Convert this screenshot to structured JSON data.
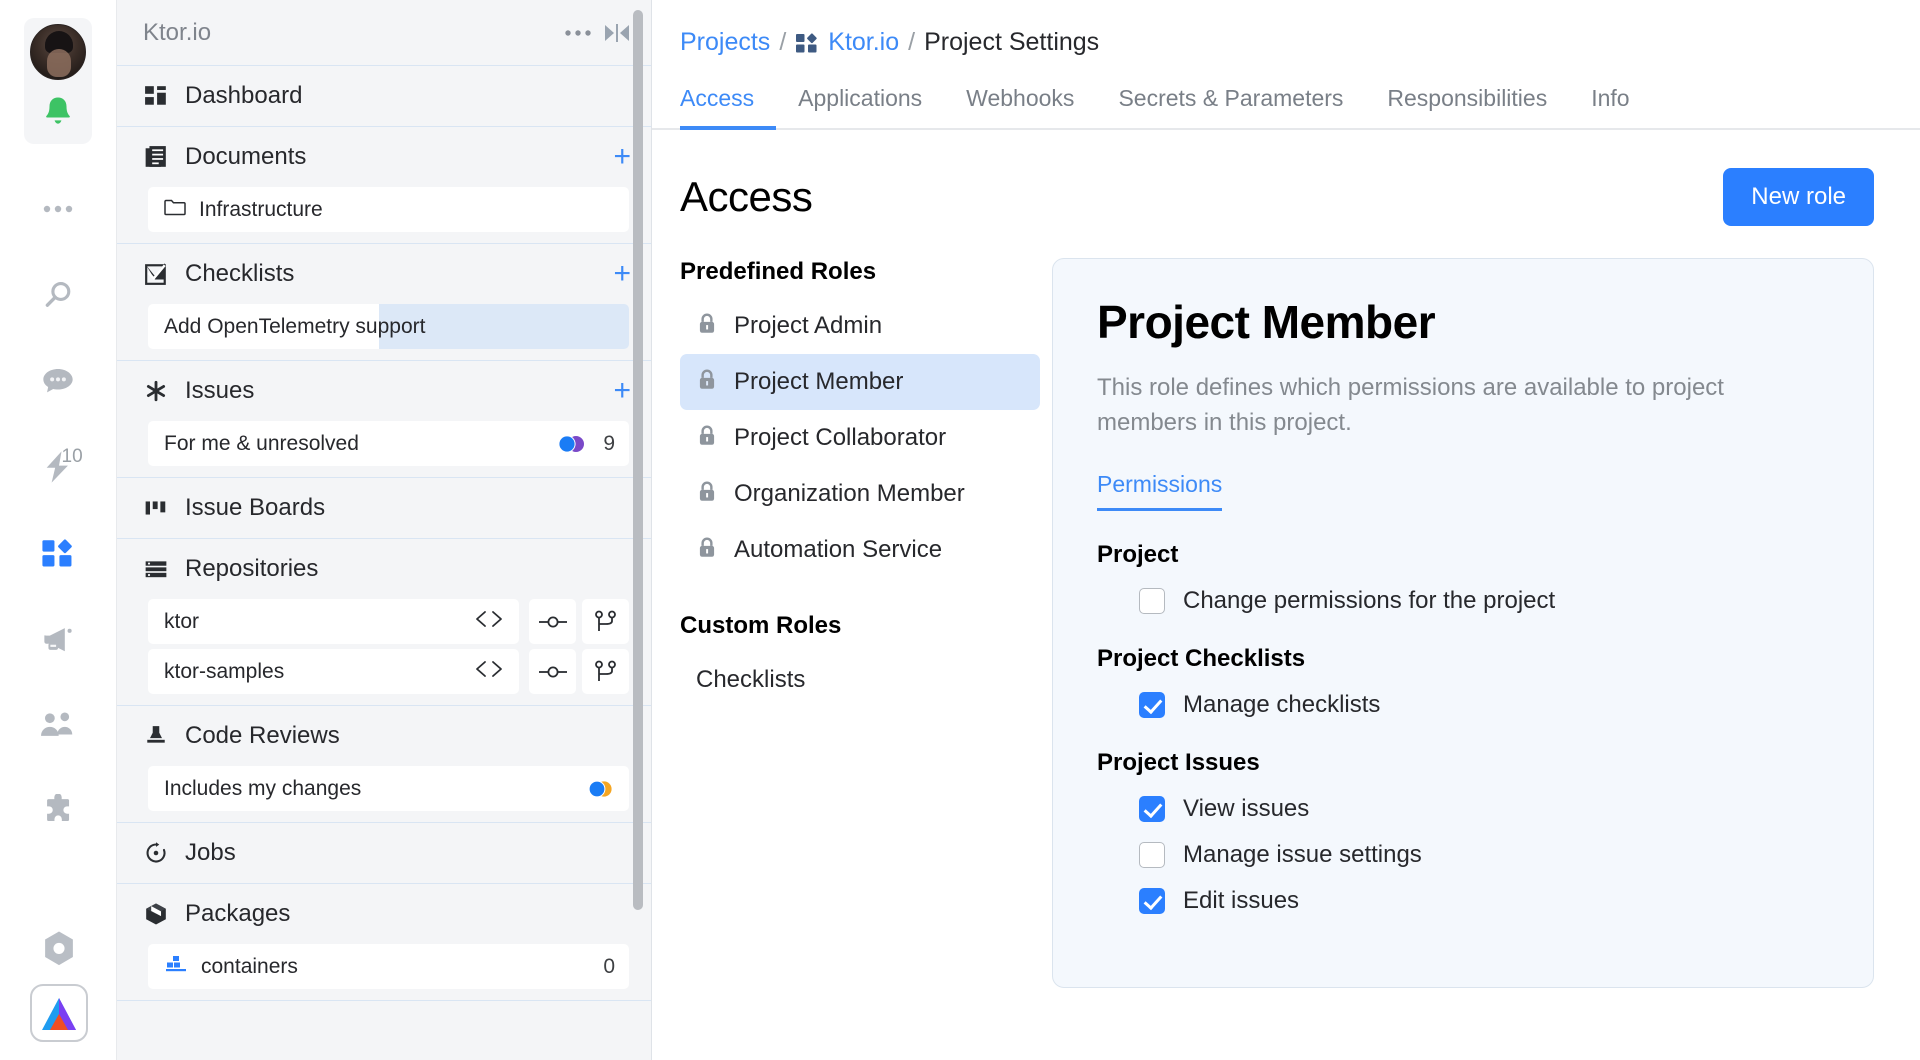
{
  "rail": {
    "avatar_name": "user-avatar",
    "notifications_icon": "bell-icon",
    "icons": [
      {
        "name": "more-icon",
        "glyph": "dots"
      },
      {
        "name": "search-icon",
        "glyph": "search"
      },
      {
        "name": "chat-icon",
        "glyph": "chat"
      },
      {
        "name": "automation-icon",
        "glyph": "bolt",
        "badge": "10"
      },
      {
        "name": "projects-icon",
        "glyph": "projects",
        "active": true
      },
      {
        "name": "blog-icon",
        "glyph": "megaphone"
      },
      {
        "name": "teams-icon",
        "glyph": "people"
      },
      {
        "name": "extensions-icon",
        "glyph": "puzzle"
      },
      {
        "name": "packages-rail-icon",
        "glyph": "hexnut"
      }
    ],
    "logo_name": "app-logo"
  },
  "sidebar": {
    "title": "Ktor.io",
    "more_icon": "ellipsis-icon",
    "collapse_icon": "collapse-panel-icon",
    "sections": [
      {
        "name": "dashboard",
        "label": "Dashboard",
        "icon": "dashboard-icon",
        "add": false,
        "children": []
      },
      {
        "name": "documents",
        "label": "Documents",
        "icon": "documents-icon",
        "add": true,
        "children": [
          {
            "name": "document-infrastructure",
            "label": "Infrastructure",
            "icon": "folder-icon"
          }
        ]
      },
      {
        "name": "checklists",
        "label": "Checklists",
        "icon": "checklist-icon",
        "add": true,
        "children": [
          {
            "name": "checklist-opentelemetry",
            "label": "Add OpenTelemetry support",
            "icon": null,
            "partial_select": true
          }
        ]
      },
      {
        "name": "issues",
        "label": "Issues",
        "icon": "issues-icon",
        "add": true,
        "children": [
          {
            "name": "issue-filter-for-me-unresolved",
            "label": "For me & unresolved",
            "icon": null,
            "count": "9",
            "avatars": true
          }
        ]
      },
      {
        "name": "issue-boards",
        "label": "Issue Boards",
        "icon": "issue-boards-icon",
        "add": false,
        "children": []
      },
      {
        "name": "repositories",
        "label": "Repositories",
        "icon": "repositories-icon",
        "add": false,
        "repos": [
          {
            "name": "repo-ktor",
            "label": "ktor",
            "actions": [
              "code-icon",
              "commits-icon",
              "branches-icon"
            ]
          },
          {
            "name": "repo-ktor-samples",
            "label": "ktor-samples",
            "actions": [
              "code-icon",
              "commits-icon",
              "branches-icon"
            ]
          }
        ]
      },
      {
        "name": "code-reviews",
        "label": "Code Reviews",
        "icon": "code-reviews-icon",
        "add": false,
        "children": [
          {
            "name": "review-filter-includes-my-changes",
            "label": "Includes my changes",
            "icon": null,
            "avatars": true
          }
        ]
      },
      {
        "name": "jobs",
        "label": "Jobs",
        "icon": "jobs-icon",
        "add": false,
        "children": []
      },
      {
        "name": "packages",
        "label": "Packages",
        "icon": "packages-icon",
        "add": false,
        "children": [
          {
            "name": "package-containers",
            "label": "containers",
            "icon": "containers-icon",
            "count": "0"
          }
        ]
      }
    ]
  },
  "breadcrumb": {
    "projects": "Projects",
    "sep1": "/",
    "project": "Ktor.io",
    "project_icon": "project-icon",
    "sep2": "/",
    "current": "Project Settings"
  },
  "tabs": [
    {
      "name": "tab-access",
      "label": "Access",
      "active": true
    },
    {
      "name": "tab-applications",
      "label": "Applications",
      "active": false
    },
    {
      "name": "tab-webhooks",
      "label": "Webhooks",
      "active": false
    },
    {
      "name": "tab-secrets-parameters",
      "label": "Secrets & Parameters",
      "active": false
    },
    {
      "name": "tab-responsibilities",
      "label": "Responsibilities",
      "active": false
    },
    {
      "name": "tab-info",
      "label": "Info",
      "active": false
    }
  ],
  "page": {
    "title": "Access",
    "new_role_button": "New role"
  },
  "roles": {
    "predefined_header": "Predefined Roles",
    "custom_header": "Custom Roles",
    "predefined": [
      {
        "name": "role-project-admin",
        "label": "Project Admin",
        "icon": "lock-icon",
        "active": false
      },
      {
        "name": "role-project-member",
        "label": "Project Member",
        "icon": "lock-icon",
        "active": true
      },
      {
        "name": "role-project-collaborator",
        "label": "Project Collaborator",
        "icon": "lock-icon",
        "active": false
      },
      {
        "name": "role-organization-member",
        "label": "Organization Member",
        "icon": "lock-icon",
        "active": false
      },
      {
        "name": "role-automation-service",
        "label": "Automation Service",
        "icon": "lock-icon",
        "active": false
      }
    ],
    "custom": [
      {
        "name": "role-checklists",
        "label": "Checklists",
        "icon": null,
        "active": false
      }
    ]
  },
  "role_detail": {
    "title": "Project Member",
    "description": "This role defines which permissions are available to project members in this project.",
    "tab_label": "Permissions",
    "groups": [
      {
        "name": "perm-group-project",
        "title": "Project",
        "items": [
          {
            "name": "perm-change-permissions-for-the-project",
            "label": "Change permissions for the project",
            "checked": false
          }
        ]
      },
      {
        "name": "perm-group-project-checklists",
        "title": "Project Checklists",
        "items": [
          {
            "name": "perm-manage-checklists",
            "label": "Manage checklists",
            "checked": true
          }
        ]
      },
      {
        "name": "perm-group-project-issues",
        "title": "Project Issues",
        "items": [
          {
            "name": "perm-view-issues",
            "label": "View issues",
            "checked": true
          },
          {
            "name": "perm-manage-issue-settings",
            "label": "Manage issue settings",
            "checked": false
          },
          {
            "name": "perm-edit-issues",
            "label": "Edit issues",
            "checked": true
          }
        ]
      }
    ]
  },
  "colors": {
    "accent": "#3d8af7",
    "button": "#2b7fff",
    "selection": "#d7e6fb",
    "sidebar_bg": "#f4f5f7",
    "card_bg": "#f4f8fd"
  }
}
